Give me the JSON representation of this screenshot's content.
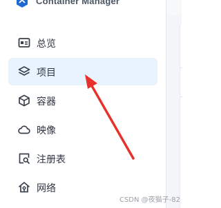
{
  "app": {
    "title": "Container Manager"
  },
  "sidebar": {
    "items": [
      {
        "label": "总览",
        "icon": "overview-icon",
        "active": false
      },
      {
        "label": "项目",
        "icon": "project-layers-icon",
        "active": true
      },
      {
        "label": "容器",
        "icon": "container-cube-icon",
        "active": false
      },
      {
        "label": "映像",
        "icon": "image-cloud-icon",
        "active": false
      },
      {
        "label": "注册表",
        "icon": "registry-search-icon",
        "active": false
      },
      {
        "label": "网络",
        "icon": "network-house-icon",
        "active": false
      }
    ]
  },
  "colors": {
    "active_item_bg": "#e8f3fd",
    "annotation_arrow": "#e8312b",
    "logo": "#1e6ad0"
  },
  "watermark": "CSDN @夜猫子-82"
}
